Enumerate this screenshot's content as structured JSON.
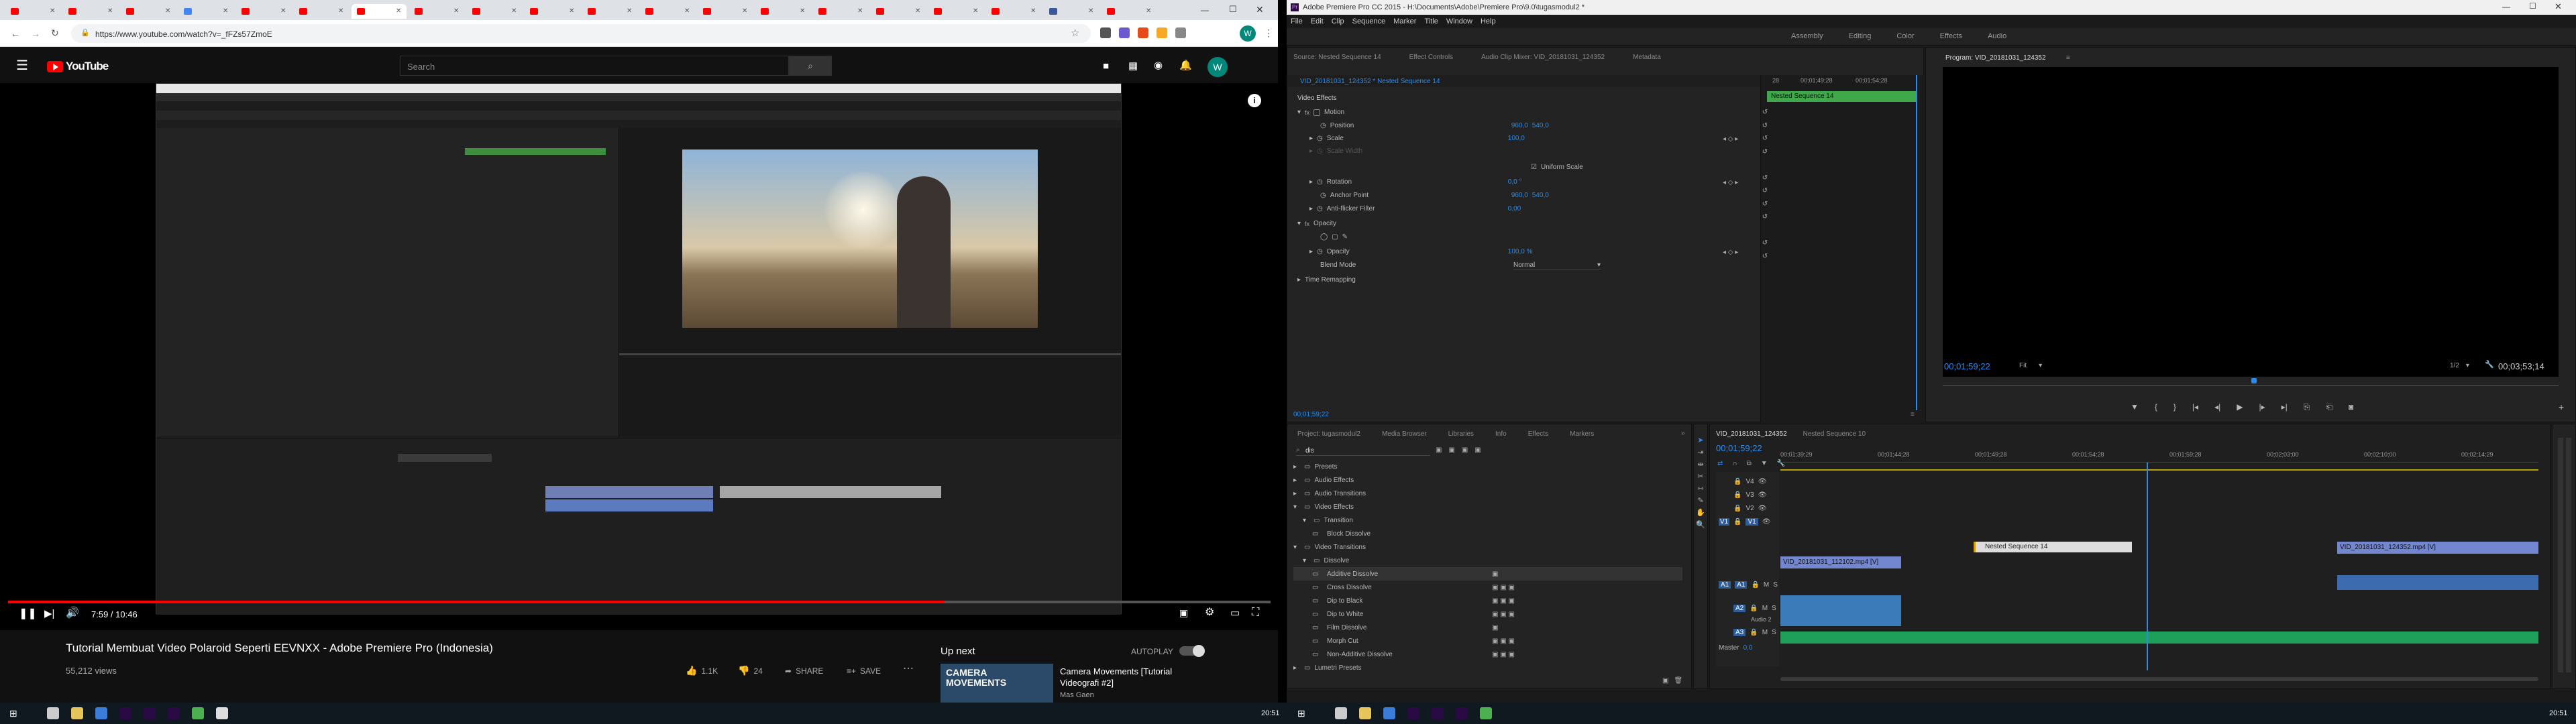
{
  "chrome": {
    "url": "https://www.youtube.com/watch?v=_fFZs57ZmoE",
    "profile": "W"
  },
  "youtube": {
    "logo": "YouTube",
    "search_placeholder": "Search",
    "avatar": "W",
    "time": "7:59 / 10:46",
    "progress": 0.742,
    "title": "Tutorial Membuat Video Polaroid Seperti EEVNXX - Adobe Premiere Pro (Indonesia)",
    "views": "55,212 views",
    "likes": "1.1K",
    "dislikes": "24",
    "share": "SHARE",
    "save": "SAVE",
    "up_next": "Up next",
    "autoplay": "AUTOPLAY",
    "next_title": "Camera Movements [Tutorial Videografi #2]",
    "next_channel": "Mas Gaen",
    "thumb_text": "CAMERA MOVEMENTS"
  },
  "pr": {
    "title": "Adobe Premiere Pro CC 2015 - H:\\Documents\\Adobe\\Premiere Pro\\9.0\\tugasmodul2 *",
    "menu": [
      "File",
      "Edit",
      "Clip",
      "Sequence",
      "Marker",
      "Title",
      "Window",
      "Help"
    ],
    "workspaces": [
      "Assembly",
      "Editing",
      "Color",
      "Effects",
      "Audio"
    ],
    "tabs_top": [
      "Source: Nested Sequence 14",
      "Effect Controls",
      "Audio Clip Mixer: VID_20181031_124352",
      "Metadata"
    ],
    "program_tab": "Program: VID_20181031_124352",
    "ec_head": "VID_20181031_124352 * Nested Sequence 14",
    "ec_ruler": [
      "28",
      "00;01;49;28",
      "00;01;54;28"
    ],
    "ec_clip": "Nested Sequence 14",
    "video_effects": "Video Effects",
    "motion": "Motion",
    "position": "Position",
    "pos_x": "960,0",
    "pos_y": "540,0",
    "scale": "Scale",
    "scale_val": "100,0",
    "scale_width": "Scale Width",
    "uniform": "Uniform Scale",
    "rotation": "Rotation",
    "rot_val": "0,0 °",
    "anchor": "Anchor Point",
    "anc_x": "960,0",
    "anc_y": "540,0",
    "anti": "Anti-flicker Filter",
    "anti_val": "0,00",
    "opacity_group": "Opacity",
    "opacity": "Opacity",
    "op_val": "100,0 %",
    "blend": "Blend Mode",
    "blend_val": "Normal",
    "remap": "Time Remapping",
    "ec_time": "00;01;59;22",
    "prog_time": "00;01;59;22",
    "fit": "Fit",
    "half": "1/2",
    "prog_dur": "00;03;53;14",
    "proj_tabs": [
      "Project: tugasmodul2",
      "Media Browser",
      "Libraries",
      "Info",
      "Effects",
      "Markers"
    ],
    "search": "dis",
    "effects_tree": [
      "Presets",
      "Audio Effects",
      "Audio Transitions",
      "Video Effects",
      "Transition",
      "Block Dissolve",
      "Video Transitions",
      "Dissolve",
      "Additive Dissolve",
      "Cross Dissolve",
      "Dip to Black",
      "Dip to White",
      "Film Dissolve",
      "Morph Cut",
      "Non-Additive Dissolve",
      "Lumetri Presets"
    ],
    "tl_tabs": [
      "VID_20181031_124352",
      "Nested Sequence 10"
    ],
    "tl_time": "00;01;59;22",
    "ruler": [
      "00;01;39;29",
      "00;01;44;28",
      "00;01;49;28",
      "00;01;54;28",
      "00;01;59;28",
      "00;02;03;00",
      "00;02;10;00",
      "00;02;14;29"
    ],
    "tracks": [
      "V3",
      "V2",
      "V1",
      "A1",
      "A2",
      "A3"
    ],
    "track_v": [
      "V4",
      "V3",
      "V2",
      "V1"
    ],
    "clip_nested": "Nested Sequence 14",
    "clip_v1a": "VID_20181031_112102.mp4 [V]",
    "clip_v1b": "VID_20181031_124352.mp4 [V]",
    "audio2": "Audio 2",
    "master": "Master",
    "master_val": "0,0"
  },
  "taskbar": {
    "clock_left": "20:51",
    "clock_right": "20:51"
  }
}
